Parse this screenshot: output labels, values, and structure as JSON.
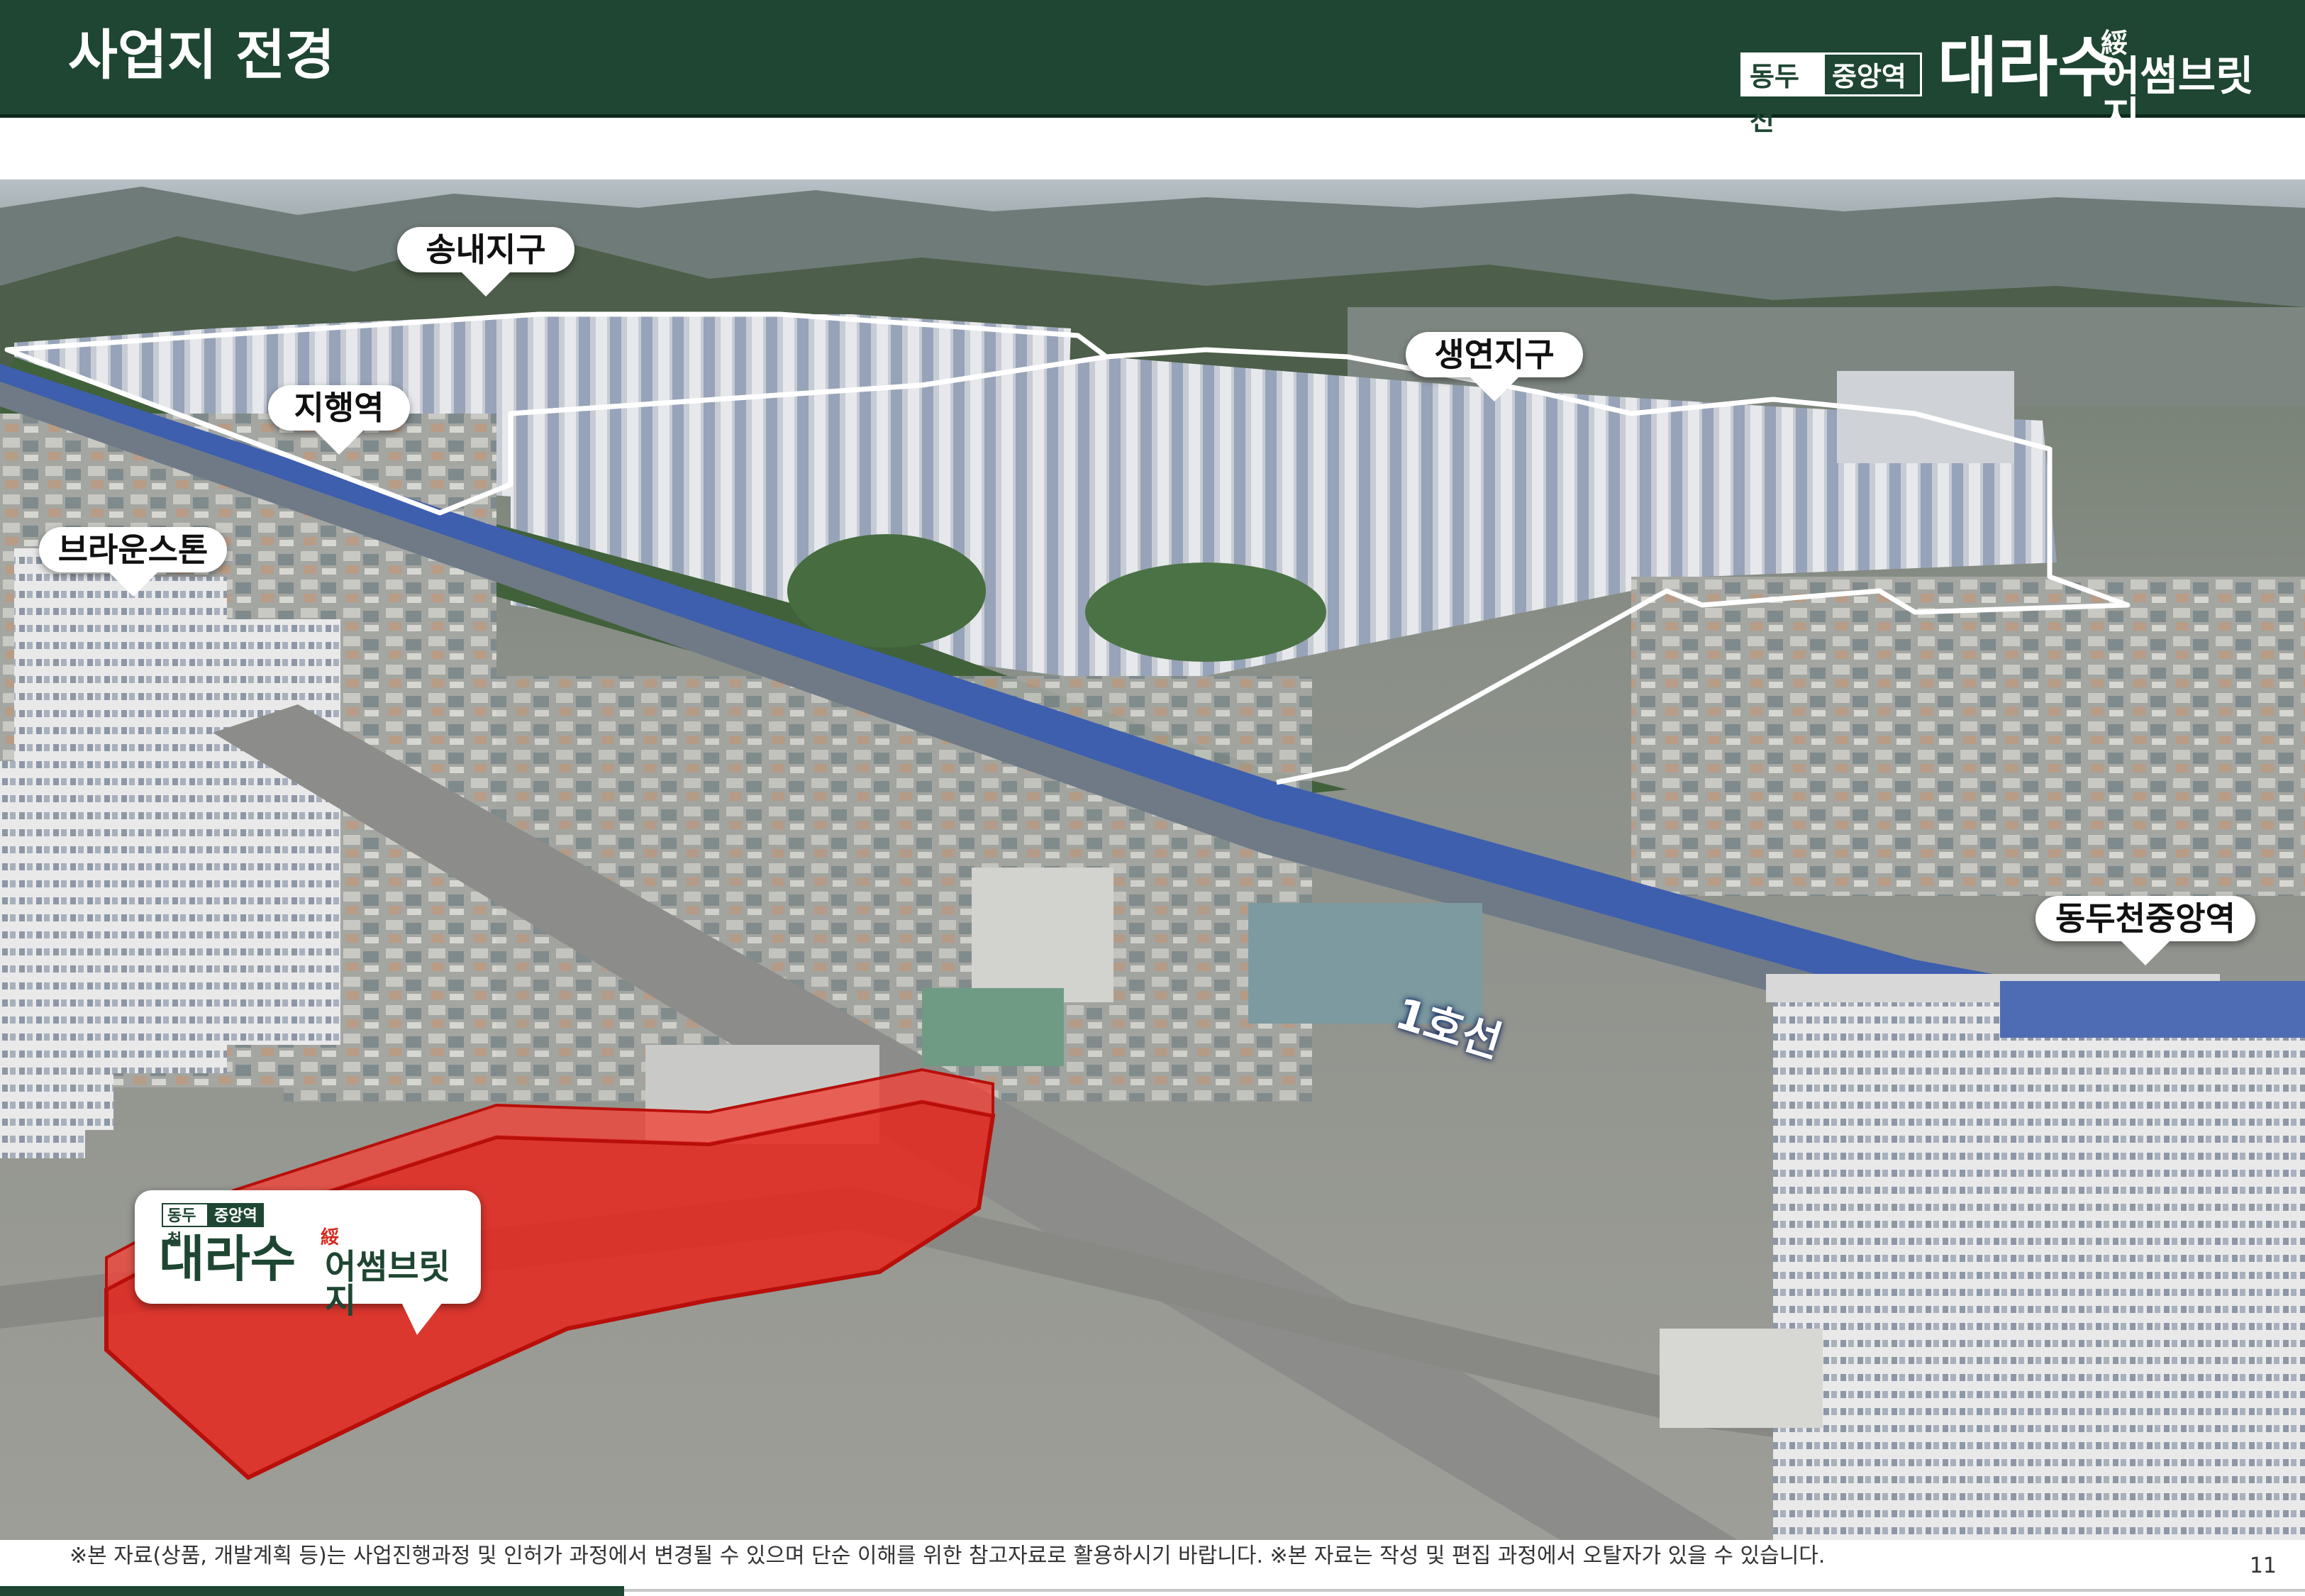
{
  "header": {
    "title": "사업지 전경",
    "brand": {
      "tag_left": "동두천",
      "tag_right": "중앙역",
      "name": "대라수",
      "hanja": "綏",
      "sub": "어썸브릿지"
    }
  },
  "photo": {
    "labels": {
      "songnae": "송내지구",
      "jihaeng": "지행역",
      "saengyeon": "생연지구",
      "brownstone": "브라운스톤",
      "dongducheon_jungang": "동두천중앙역",
      "line1": "1호선"
    },
    "site_card": {
      "tag_left": "동두천",
      "tag_right": "중앙역",
      "name": "대라수",
      "hanja": "綏",
      "sub": "어썸브릿지"
    },
    "colors": {
      "site_fill": "#e8261c",
      "railway": "#3e5fae",
      "outline": "#ffffff"
    }
  },
  "footer": {
    "disclaimer": "※본 자료(상품, 개발계획 등)는 사업진행과정 및 인허가 과정에서 변경될 수 있으며 단순 이해를 위한 참고자료로 활용하시기 바랍니다. ※본 자료는 작성 및 편집 과정에서 오탈자가 있을 수 있습니다.",
    "page_number": "11"
  }
}
